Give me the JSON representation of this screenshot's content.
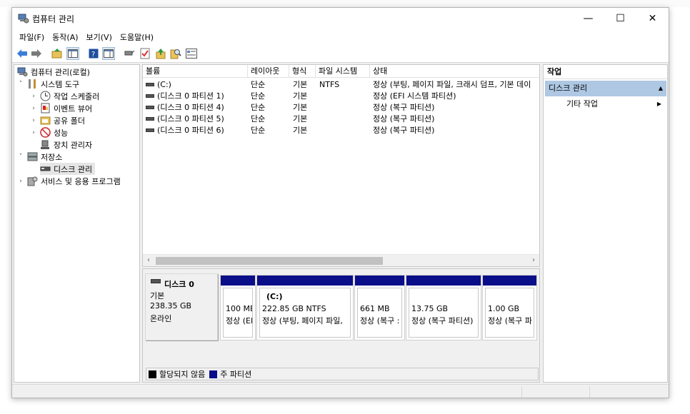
{
  "window": {
    "title": "컴퓨터 관리",
    "controls": {
      "minimize": "—",
      "maximize": "☐",
      "close": "✕"
    }
  },
  "menu": [
    "파일(F)",
    "동작(A)",
    "보기(V)",
    "도움말(H)"
  ],
  "toolbar_icons": [
    "back-arrow-icon",
    "forward-arrow-icon",
    "up-folder-icon",
    "show-hide-tree-icon",
    "help-icon",
    "console-view-icon",
    "connect-icon",
    "checklist-icon",
    "export-icon",
    "search-icon",
    "properties-icon"
  ],
  "tree": {
    "root": "컴퓨터 관리(로컬)",
    "system_tools": "시스템 도구",
    "task_scheduler": "작업 스케줄러",
    "event_viewer": "이벤트 뷰어",
    "shared_folders": "공유 폴더",
    "performance": "성능",
    "device_manager": "장치 관리자",
    "storage": "저장소",
    "disk_management": "디스크 관리",
    "services_apps": "서비스 및 응용 프로그램"
  },
  "volume_list": {
    "columns": [
      "볼륨",
      "레이아웃",
      "형식",
      "파일 시스템",
      "상태"
    ],
    "rows": [
      {
        "volume": "(C:)",
        "layout": "단순",
        "type": "기본",
        "fs": "NTFS",
        "status": "정상 (부팅, 페이지 파일, 크래시 덤프, 기본 데이"
      },
      {
        "volume": "(디스크 0 파티션 1)",
        "layout": "단순",
        "type": "기본",
        "fs": "",
        "status": "정상 (EFI 시스템 파티션)"
      },
      {
        "volume": "(디스크 0 파티션 4)",
        "layout": "단순",
        "type": "기본",
        "fs": "",
        "status": "정상 (복구 파티션)"
      },
      {
        "volume": "(디스크 0 파티션 5)",
        "layout": "단순",
        "type": "기본",
        "fs": "",
        "status": "정상 (복구 파티션)"
      },
      {
        "volume": "(디스크 0 파티션 6)",
        "layout": "단순",
        "type": "기본",
        "fs": "",
        "status": "정상 (복구 파티션)"
      }
    ],
    "scroll_left": "‹",
    "scroll_right": "›"
  },
  "disk": {
    "name": "디스크 0",
    "type": "기본",
    "size": "238.35 GB",
    "state": "온라인",
    "partitions": [
      {
        "title": "",
        "size": "100 ME",
        "status": "정상 (EI"
      },
      {
        "title": "(C:)",
        "size": "222.85 GB NTFS",
        "status": "정상 (부팅, 페이지 파일,"
      },
      {
        "title": "",
        "size": "661 MB",
        "status": "정상 (복구 :"
      },
      {
        "title": "",
        "size": "13.75 GB",
        "status": "정상 (복구 파티션)"
      },
      {
        "title": "",
        "size": "1.00 GB",
        "status": "정상 (복구 파"
      }
    ]
  },
  "legend": {
    "unallocated": "할당되지 않음",
    "primary": "주 파티션",
    "unallocated_color": "#000000",
    "primary_color": "#0a0e88"
  },
  "actions": {
    "title": "작업",
    "section": "디스크 관리",
    "section_collapse": "▲",
    "more": "기타 작업",
    "more_arrow": "▶"
  }
}
